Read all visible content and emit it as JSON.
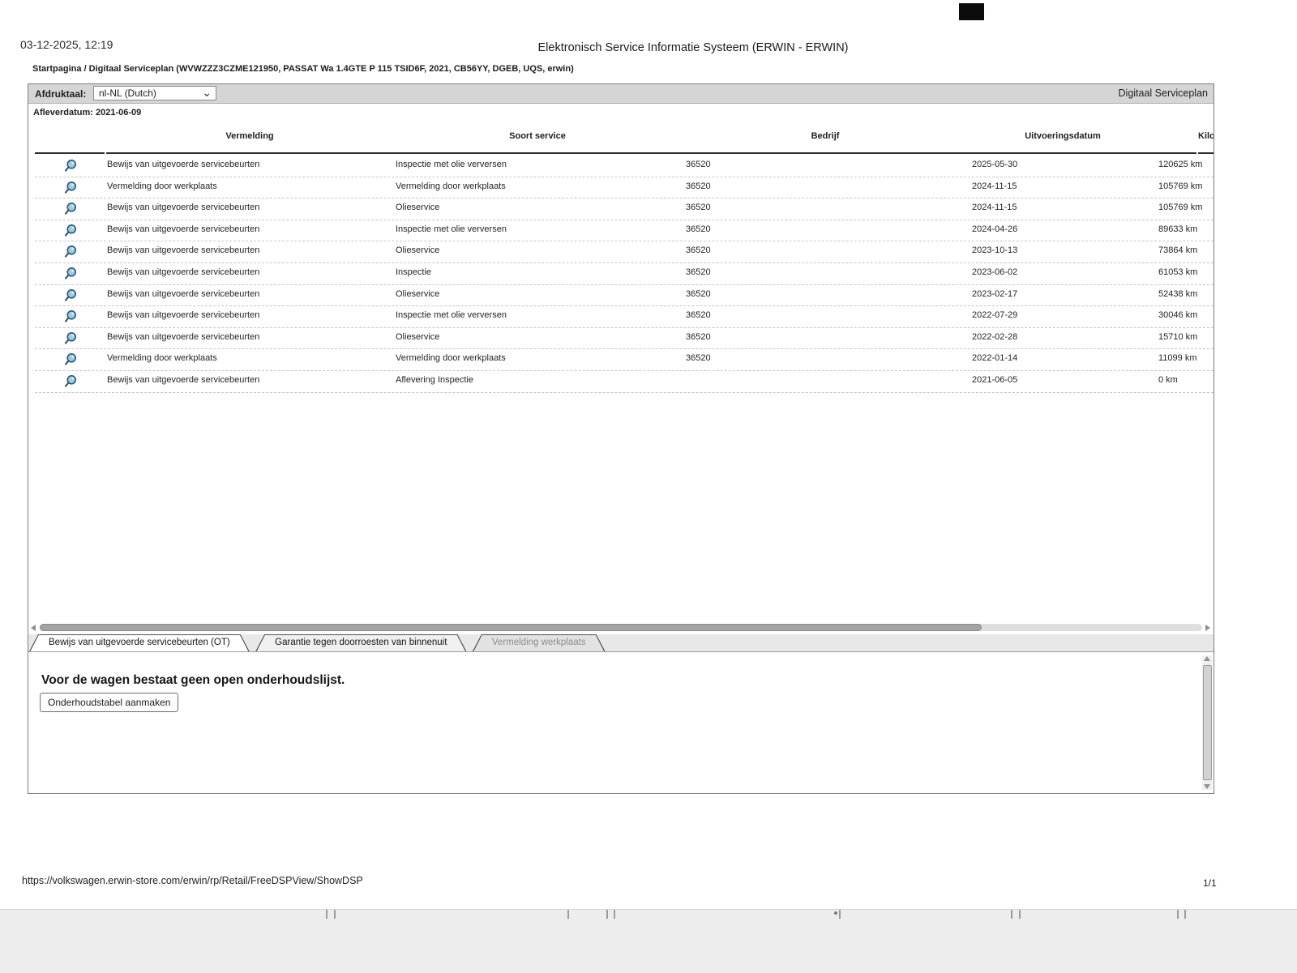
{
  "page": {
    "printed_datetime": "03-12-2025, 12:19",
    "title": "Elektronisch Service Informatie Systeem (ERWIN - ERWIN)",
    "breadcrumb": "Startpagina / Digitaal Serviceplan (WVWZZZ3CZME121950, PASSAT Wa 1.4GTE P 115 TSID6F, 2021, CB56YY, DGEB, UQS, erwin)",
    "footer_url": "https://volkswagen.erwin-store.com/erwin/rp/Retail/FreeDSPView/ShowDSP",
    "page_number": "1/1"
  },
  "toolbar": {
    "print_language_label": "Afdruktaal:",
    "print_language_value": "nl-NL (Dutch)",
    "right_title": "Digitaal Serviceplan"
  },
  "delivery_date_line": "Afleverdatum: 2021-06-09",
  "table": {
    "columns": [
      "Vermelding",
      "Soort service",
      "Bedrijf",
      "Uitvoeringsdatum",
      "Kilo"
    ],
    "rows": [
      {
        "vermelding": "Bewijs van uitgevoerde servicebeurten",
        "soort": "Inspectie met olie verversen",
        "bedrijf": "36520",
        "datum": "2025-05-30",
        "km": "120625 km"
      },
      {
        "vermelding": "Vermelding door werkplaats",
        "soort": "Vermelding door werkplaats",
        "bedrijf": "36520",
        "datum": "2024-11-15",
        "km": "105769 km"
      },
      {
        "vermelding": "Bewijs van uitgevoerde servicebeurten",
        "soort": "Olieservice",
        "bedrijf": "36520",
        "datum": "2024-11-15",
        "km": "105769 km"
      },
      {
        "vermelding": "Bewijs van uitgevoerde servicebeurten",
        "soort": "Inspectie met olie verversen",
        "bedrijf": "36520",
        "datum": "2024-04-26",
        "km": "89633 km"
      },
      {
        "vermelding": "Bewijs van uitgevoerde servicebeurten",
        "soort": "Olieservice",
        "bedrijf": "36520",
        "datum": "2023-10-13",
        "km": "73864 km"
      },
      {
        "vermelding": "Bewijs van uitgevoerde servicebeurten",
        "soort": "Inspectie",
        "bedrijf": "36520",
        "datum": "2023-06-02",
        "km": "61053 km"
      },
      {
        "vermelding": "Bewijs van uitgevoerde servicebeurten",
        "soort": "Olieservice",
        "bedrijf": "36520",
        "datum": "2023-02-17",
        "km": "52438 km"
      },
      {
        "vermelding": "Bewijs van uitgevoerde servicebeurten",
        "soort": "Inspectie met olie verversen",
        "bedrijf": "36520",
        "datum": "2022-07-29",
        "km": "30046 km"
      },
      {
        "vermelding": "Bewijs van uitgevoerde servicebeurten",
        "soort": "Olieservice",
        "bedrijf": "36520",
        "datum": "2022-02-28",
        "km": "15710 km"
      },
      {
        "vermelding": "Vermelding door werkplaats",
        "soort": "Vermelding door werkplaats",
        "bedrijf": "36520",
        "datum": "2022-01-14",
        "km": "11099 km"
      },
      {
        "vermelding": "Bewijs van uitgevoerde servicebeurten",
        "soort": "Aflevering Inspectie",
        "bedrijf": "",
        "datum": "2021-06-05",
        "km": "0 km"
      }
    ]
  },
  "tabs": [
    {
      "label": "Bewijs van uitgevoerde servicebeurten (OT)",
      "state": "active"
    },
    {
      "label": "Garantie tegen doorroesten van binnenuit",
      "state": "normal"
    },
    {
      "label": "Vermelding werkplaats",
      "state": "disabled"
    }
  ],
  "bottom_panel": {
    "message": "Voor de wagen bestaat geen open onderhoudslijst.",
    "button_label": "Onderhoudstabel aanmaken"
  },
  "icons": {
    "magnifier": "magnifier-icon",
    "chevron_down": "⌄",
    "arrow_left": "",
    "arrow_right": "",
    "arrow_up": "",
    "arrow_down": ""
  },
  "colors": {
    "magnifier_fill": "#9ccbe6",
    "magnifier_stroke": "#2a5878",
    "toolbar_gray": "#d5d5d5",
    "tabstrip_gray": "#e8e8e8"
  }
}
